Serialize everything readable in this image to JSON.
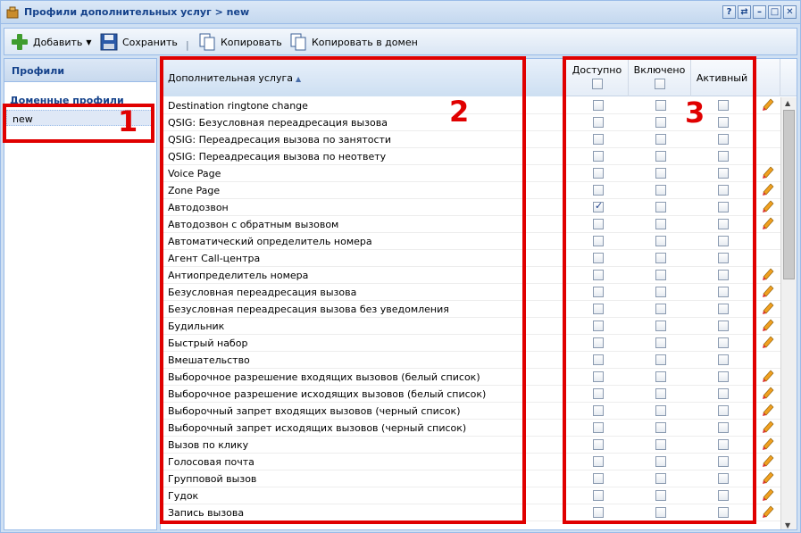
{
  "window": {
    "title": "Профили дополнительных услуг > new"
  },
  "title_buttons": [
    "?",
    "⇄",
    "–",
    "□",
    "✕"
  ],
  "toolbar": {
    "add_label": "Добавить",
    "save_label": "Сохранить",
    "separator": "|",
    "copy_label": "Копировать",
    "copy_domain_label": "Копировать в домен"
  },
  "left_panel": {
    "header": "Профили",
    "section": "Доменные профили",
    "items": [
      "new"
    ]
  },
  "grid": {
    "columns": {
      "service": "Дополнительная услуга",
      "available": "Доступно",
      "enabled": "Включено",
      "active": "Активный"
    },
    "rows": [
      {
        "name": "Destination ringtone change",
        "available": false,
        "edit": true
      },
      {
        "name": "QSIG: Безусловная переадресация вызова",
        "available": false,
        "edit": false
      },
      {
        "name": "QSIG: Переадресация вызова по занятости",
        "available": false,
        "edit": false
      },
      {
        "name": "QSIG: Переадресация вызова по неответу",
        "available": false,
        "edit": false
      },
      {
        "name": "Voice Page",
        "available": false,
        "edit": true
      },
      {
        "name": "Zone Page",
        "available": false,
        "edit": true
      },
      {
        "name": "Автодозвон",
        "available": true,
        "edit": true
      },
      {
        "name": "Автодозвон с обратным вызовом",
        "available": false,
        "edit": true
      },
      {
        "name": "Автоматический определитель номера",
        "available": false,
        "edit": false
      },
      {
        "name": "Агент Call-центра",
        "available": false,
        "edit": false
      },
      {
        "name": "Антиопределитель номера",
        "available": false,
        "edit": true
      },
      {
        "name": "Безусловная переадресация вызова",
        "available": false,
        "edit": true
      },
      {
        "name": "Безусловная переадресация вызова без уведомления",
        "available": false,
        "edit": true
      },
      {
        "name": "Будильник",
        "available": false,
        "edit": true
      },
      {
        "name": "Быстрый набор",
        "available": false,
        "edit": true
      },
      {
        "name": "Вмешательство",
        "available": false,
        "edit": false
      },
      {
        "name": "Выборочное разрешение входящих вызовов (белый список)",
        "available": false,
        "edit": true
      },
      {
        "name": "Выборочное разрешение исходящих вызовов (белый список)",
        "available": false,
        "edit": true
      },
      {
        "name": "Выборочный запрет входящих вызовов (черный список)",
        "available": false,
        "edit": true
      },
      {
        "name": "Выборочный запрет исходящих вызовов (черный список)",
        "available": false,
        "edit": true
      },
      {
        "name": "Вызов по клику",
        "available": false,
        "edit": true
      },
      {
        "name": "Голосовая почта",
        "available": false,
        "edit": true
      },
      {
        "name": "Групповой вызов",
        "available": false,
        "edit": true
      },
      {
        "name": "Гудок",
        "available": false,
        "edit": true
      },
      {
        "name": "Запись вызова",
        "available": false,
        "edit": true
      }
    ]
  },
  "annotations": [
    "1",
    "2",
    "3"
  ],
  "colors": {
    "accent": "#15428b",
    "annotation": "#e00000",
    "header_bg": "#dfe8f6"
  }
}
